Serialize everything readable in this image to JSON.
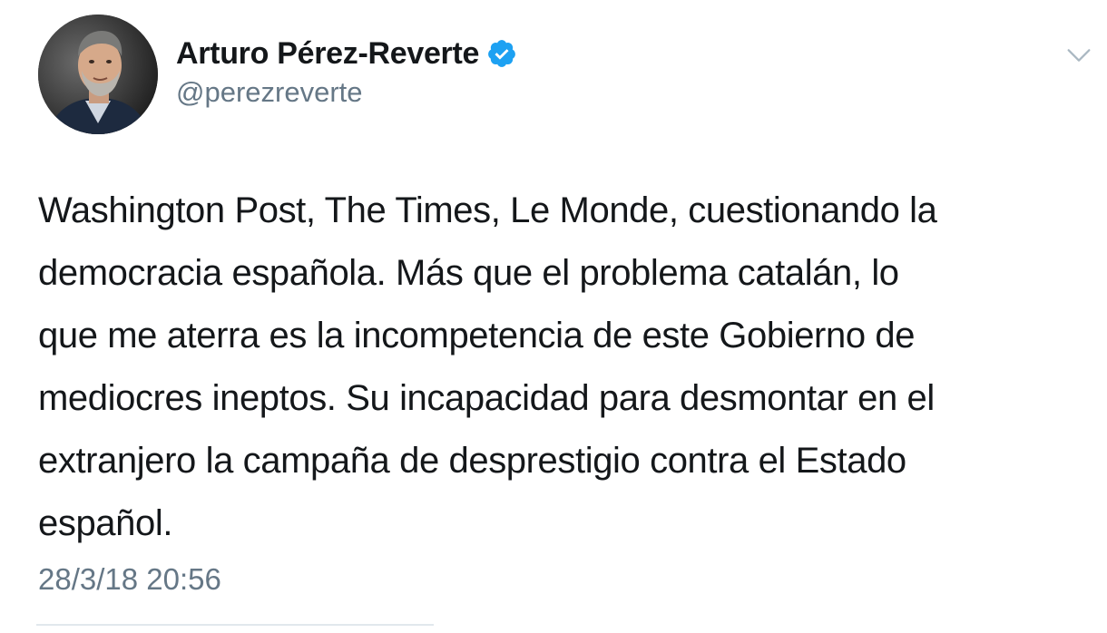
{
  "tweet": {
    "author": {
      "display_name": "Arturo Pérez-Reverte",
      "handle": "@perezreverte",
      "verified": true,
      "verified_icon": "verified-badge-icon",
      "avatar": "profile-photo"
    },
    "menu_icon": "chevron-down-icon",
    "text_lines": [
      "Washington Post, The Times, Le Monde, cuestionando la",
      "democracia española. Más que el problema catalán, lo",
      "que me aterra es la incompetencia de este Gobierno de",
      "mediocres ineptos. Su incapacidad para desmontar en el",
      "extranjero la campaña de desprestigio contra el Estado",
      "español."
    ],
    "timestamp": "28/3/18 20:56"
  },
  "colors": {
    "text_primary": "#14171a",
    "text_secondary": "#657786",
    "verified_blue": "#1da1f2",
    "divider": "#e1e8ed"
  }
}
